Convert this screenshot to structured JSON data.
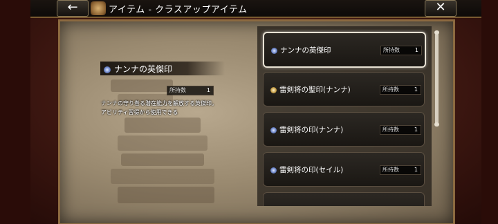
{
  "header": {
    "title": "アイテム - クラスアップアイテム",
    "back_icon": "←",
    "close_icon": "✕"
  },
  "detail": {
    "name": "ナンナの英傑印",
    "gem": "blue",
    "qty_label": "所持数",
    "qty_value": "1",
    "description_lines": [
      "ナンナの守り巻る潜在能力を解放する英傑印。",
      "アビリティ習得から使用できる"
    ]
  },
  "list": {
    "items": [
      {
        "name": "ナンナの英傑印",
        "gem": "blue",
        "qty_label": "所持数",
        "qty_value": "1",
        "selected": true
      },
      {
        "name": "雷剣将の聖印(ナンナ)",
        "gem": "gold",
        "qty_label": "所持数",
        "qty_value": "1",
        "selected": false
      },
      {
        "name": "雷剣将の印(ナンナ)",
        "gem": "blue",
        "qty_label": "所持数",
        "qty_value": "1",
        "selected": false
      },
      {
        "name": "雷剣将の印(セイル)",
        "gem": "blue",
        "qty_label": "所持数",
        "qty_value": "1",
        "selected": false
      }
    ]
  },
  "colors": {
    "frame_gold": "#8c6a40",
    "parchment": "#9a8a70",
    "selected_border": "#e8e2d4"
  }
}
